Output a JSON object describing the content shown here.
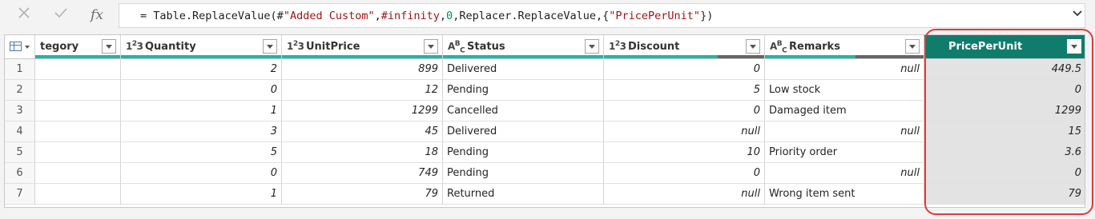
{
  "formula_bar": {
    "cancel_icon": "close-icon",
    "commit_icon": "check-icon",
    "fx_label": "fx",
    "formula_parts": [
      {
        "text": "= Table.ReplaceValue(#",
        "kind": "plain"
      },
      {
        "text": "\"Added Custom\"",
        "kind": "str"
      },
      {
        "text": ",",
        "kind": "plain"
      },
      {
        "text": "#infinity",
        "kind": "kw"
      },
      {
        "text": ",",
        "kind": "plain"
      },
      {
        "text": "0",
        "kind": "num"
      },
      {
        "text": ",Replacer.ReplaceValue,{",
        "kind": "plain"
      },
      {
        "text": "\"PricePerUnit\"",
        "kind": "str"
      },
      {
        "text": "})",
        "kind": "plain"
      }
    ],
    "expand_icon": "chevron-down-icon"
  },
  "grid": {
    "columns": [
      {
        "key": "category",
        "label": "tegory",
        "type": "",
        "quality_pct": 100
      },
      {
        "key": "quantity",
        "label": "Quantity",
        "type": "123",
        "quality_pct": 100
      },
      {
        "key": "unitprice",
        "label": "UnitPrice",
        "type": "123",
        "quality_pct": 100
      },
      {
        "key": "status",
        "label": "Status",
        "type": "ABC",
        "quality_pct": 100
      },
      {
        "key": "discount",
        "label": "Discount",
        "type": "123",
        "quality_pct": 71
      },
      {
        "key": "remarks",
        "label": "Remarks",
        "type": "ABC",
        "quality_pct": 57
      },
      {
        "key": "pricePerUnit",
        "label": "PricePerUnit",
        "type": "",
        "quality_pct": 100,
        "selected": true
      }
    ],
    "rows": [
      {
        "n": "1",
        "category": "",
        "quantity": "2",
        "unitprice": "899",
        "status": "Delivered",
        "discount": "0",
        "remarks": "null",
        "pricePerUnit": "449.5"
      },
      {
        "n": "2",
        "category": "",
        "quantity": "0",
        "unitprice": "12",
        "status": "Pending",
        "discount": "5",
        "remarks": "Low stock",
        "pricePerUnit": "0"
      },
      {
        "n": "3",
        "category": "",
        "quantity": "1",
        "unitprice": "1299",
        "status": "Cancelled",
        "discount": "0",
        "remarks": "Damaged item",
        "pricePerUnit": "1299"
      },
      {
        "n": "4",
        "category": "",
        "quantity": "3",
        "unitprice": "45",
        "status": "Delivered",
        "discount": "null",
        "remarks": "null",
        "pricePerUnit": "15"
      },
      {
        "n": "5",
        "category": "",
        "quantity": "5",
        "unitprice": "18",
        "status": "Pending",
        "discount": "10",
        "remarks": "Priority order",
        "pricePerUnit": "3.6"
      },
      {
        "n": "6",
        "category": "",
        "quantity": "0",
        "unitprice": "749",
        "status": "Pending",
        "discount": "0",
        "remarks": "null",
        "pricePerUnit": "0"
      },
      {
        "n": "7",
        "category": "",
        "quantity": "1",
        "unitprice": "79",
        "status": "Returned",
        "discount": "null",
        "remarks": "Wrong item sent",
        "pricePerUnit": "79"
      }
    ]
  },
  "colors": {
    "selected_header": "#107c6b",
    "quality_bar": "#22b3a6",
    "highlight": "#e03a3a"
  }
}
